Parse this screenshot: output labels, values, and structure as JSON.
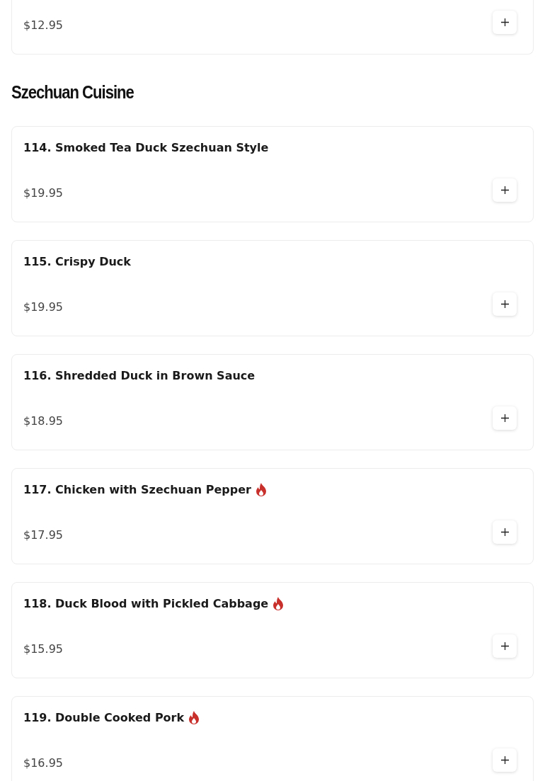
{
  "previous_item": {
    "price": "$12.95"
  },
  "section": {
    "title": "Szechuan Cuisine",
    "items": [
      {
        "name": "114. Smoked Tea Duck Szechuan Style",
        "price": "$19.95",
        "spicy": false
      },
      {
        "name": "115. Crispy Duck",
        "price": "$19.95",
        "spicy": false
      },
      {
        "name": "116. Shredded Duck in Brown Sauce",
        "price": "$18.95",
        "spicy": false
      },
      {
        "name": "117. Chicken with Szechuan Pepper",
        "price": "$17.95",
        "spicy": true
      },
      {
        "name": "118. Duck Blood with Pickled Cabbage",
        "price": "$15.95",
        "spicy": true
      },
      {
        "name": "119. Double Cooked Pork",
        "price": "$16.95",
        "spicy": true
      }
    ]
  }
}
